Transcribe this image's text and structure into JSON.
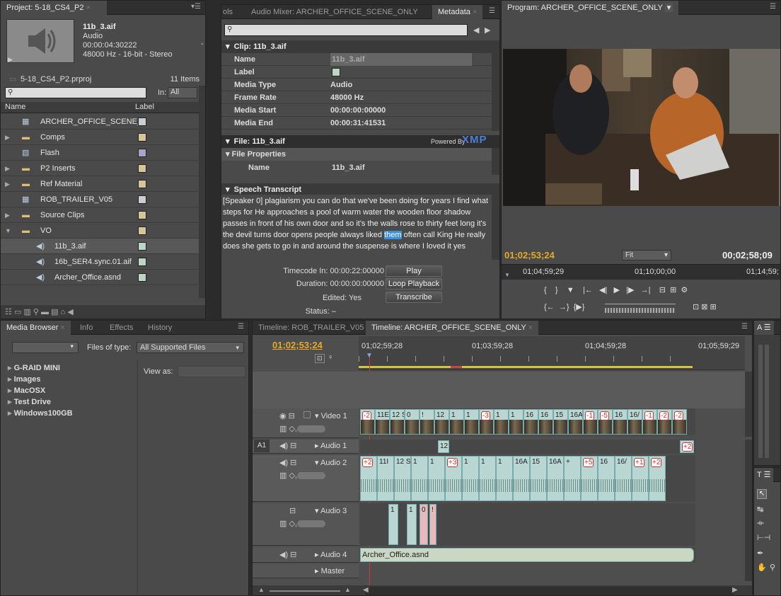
{
  "project": {
    "tab": "Project: 5-18_CS4_P2",
    "clip_name": "11b_3.aif",
    "clip_type": "Audio",
    "clip_duration": "00:00:04:30222",
    "clip_format": "48000 Hz - 16-bit - Stereo",
    "proj_file": "5-18_CS4_P2.prproj",
    "items_count": "11 Items",
    "in_label": "In:",
    "in_value": "All",
    "col_name": "Name",
    "col_label": "Label",
    "items": [
      {
        "name": "ARCHER_OFFICE_SCENE_",
        "icon": "sequence-icon",
        "color": "#c9cfd1",
        "expand": "",
        "indent": 0
      },
      {
        "name": "Comps",
        "icon": "folder-icon",
        "color": "#d6c59a",
        "expand": "▶",
        "indent": 0
      },
      {
        "name": "Flash",
        "icon": "flash-file-icon",
        "color": "#a9a3cc",
        "expand": "",
        "indent": 0
      },
      {
        "name": "P2 Inserts",
        "icon": "folder-icon",
        "color": "#d6c59a",
        "expand": "▶",
        "indent": 0
      },
      {
        "name": "Ref Material",
        "icon": "folder-icon",
        "color": "#d6c59a",
        "expand": "▶",
        "indent": 0
      },
      {
        "name": "ROB_TRAILER_V05",
        "icon": "sequence-icon",
        "color": "#c9cfd1",
        "expand": "",
        "indent": 0
      },
      {
        "name": "Source Clips",
        "icon": "folder-icon",
        "color": "#d6c59a",
        "expand": "▶",
        "indent": 0
      },
      {
        "name": "VO",
        "icon": "folder-icon",
        "color": "#d6c59a",
        "expand": "▼",
        "indent": 0
      },
      {
        "name": "11b_3.aif",
        "icon": "audio-icon",
        "color": "#bcd6c6",
        "expand": "",
        "indent": 1
      },
      {
        "name": "16b_SER4.sync.01.aif",
        "icon": "audio-icon",
        "color": "#bcd6c6",
        "expand": "",
        "indent": 1
      },
      {
        "name": "Archer_Office.asnd",
        "icon": "audio-icon",
        "color": "#bcd6c6",
        "expand": "",
        "indent": 1
      }
    ]
  },
  "metadata": {
    "tab_left": "ols",
    "tab_mixer": "Audio Mixer: ARCHER_OFFICE_SCENE_ONLY",
    "tab_meta": "Metadata",
    "clip_header": "Clip: 11b_3.aif",
    "clip_rows": [
      {
        "label": "Name",
        "value": "11b_3.aif"
      },
      {
        "label": "Label",
        "value": ""
      },
      {
        "label": "Media Type",
        "value": "Audio"
      },
      {
        "label": "Frame Rate",
        "value": "48000 Hz"
      },
      {
        "label": "Media Start",
        "value": "00:00:00:00000"
      },
      {
        "label": "Media End",
        "value": "00:00:31:41531"
      }
    ],
    "file_header": "File: 11b_3.aif",
    "powered": "Powered By",
    "xmp": "XMP",
    "file_props": "File Properties",
    "file_name_label": "Name",
    "file_name_value": "11b_3.aif",
    "speech_header": "Speech Transcript",
    "transcript_before": "[Speaker 0] plagiarism you can do that we've been doing for years I find what steps for He approaches a pool of warm water the wooden floor shadow passes in front of his own door and so it's the walls rose to thirty feet long it's the devil turns door opens people always liked ",
    "transcript_highlight": "them",
    "transcript_after": " often call King He really does she gets to go in and around the suspense is where I loved it yes",
    "tc_in_label": "Timecode In:",
    "tc_in": "00:00:22:00000",
    "play": "Play",
    "duration_label": "Duration:",
    "duration": "00:00:00:00000",
    "loop": "Loop Playback",
    "edited_label": "Edited:",
    "edited": "Yes",
    "transcribe": "Transcribe",
    "status_label": "Status:",
    "status": "–"
  },
  "program": {
    "tab": "Program: ARCHER_OFFICE_SCENE_ONLY",
    "tc_current": "01;02;53;24",
    "fit": "Fit",
    "tc_duration": "00;02;58;09",
    "ruler": [
      "01;04;59;29",
      "01;10;00;00",
      "01;14;59;"
    ]
  },
  "media": {
    "tabs": [
      "Media Browser",
      "Info",
      "Effects",
      "History"
    ],
    "files_of_type_label": "Files of type:",
    "files_of_type": "All Supported Files",
    "view_as": "View as:",
    "drives": [
      "G-RAID MINI",
      "Images",
      "MacOSX",
      "Test Drive",
      "Windows100GB"
    ]
  },
  "timeline": {
    "tab1": "Timeline: ROB_TRAILER_V05",
    "tab2": "Timeline: ARCHER_OFFICE_SCENE_ONLY",
    "tc": "01;02;53;24",
    "ruler": [
      "01;02;59;28",
      "01;03;59;28",
      "01;04;59;28",
      "01;05;59;29"
    ],
    "tracks": {
      "video1": "Video 1",
      "a1": "A1",
      "audio1": "Audio 1",
      "audio2": "Audio 2",
      "audio3": "Audio 3",
      "audio4": "Audio 4",
      "master": "Master"
    },
    "video_clips": [
      "-2",
      "11E",
      "12 SER",
      "0",
      "!",
      "12",
      "1",
      "1",
      "-3",
      "1",
      "1",
      "16",
      "16",
      "15",
      "16A",
      "-1",
      "-5",
      "16",
      "16/",
      "-1",
      "-2",
      "-2"
    ],
    "a2_clips": [
      "+2",
      "11I",
      "12 SER",
      "1",
      "1",
      "+3",
      "1",
      "1",
      "1",
      "16A",
      "15",
      "16A",
      "+",
      "+5",
      "16",
      "16/",
      "+1",
      "+2"
    ],
    "a1_clips": [
      "12",
      "+2"
    ],
    "a3_clips": [
      "1",
      "1",
      "0",
      "!"
    ],
    "a4_clip": "Archer_Office.asnd"
  },
  "colors": {
    "accent_orange": "#e6a92a",
    "playhead": "#d23a2a",
    "clip_audio": "#b9d6d2",
    "clip_pink": "#e6b9bd",
    "highlight": "#3c8ed6"
  }
}
